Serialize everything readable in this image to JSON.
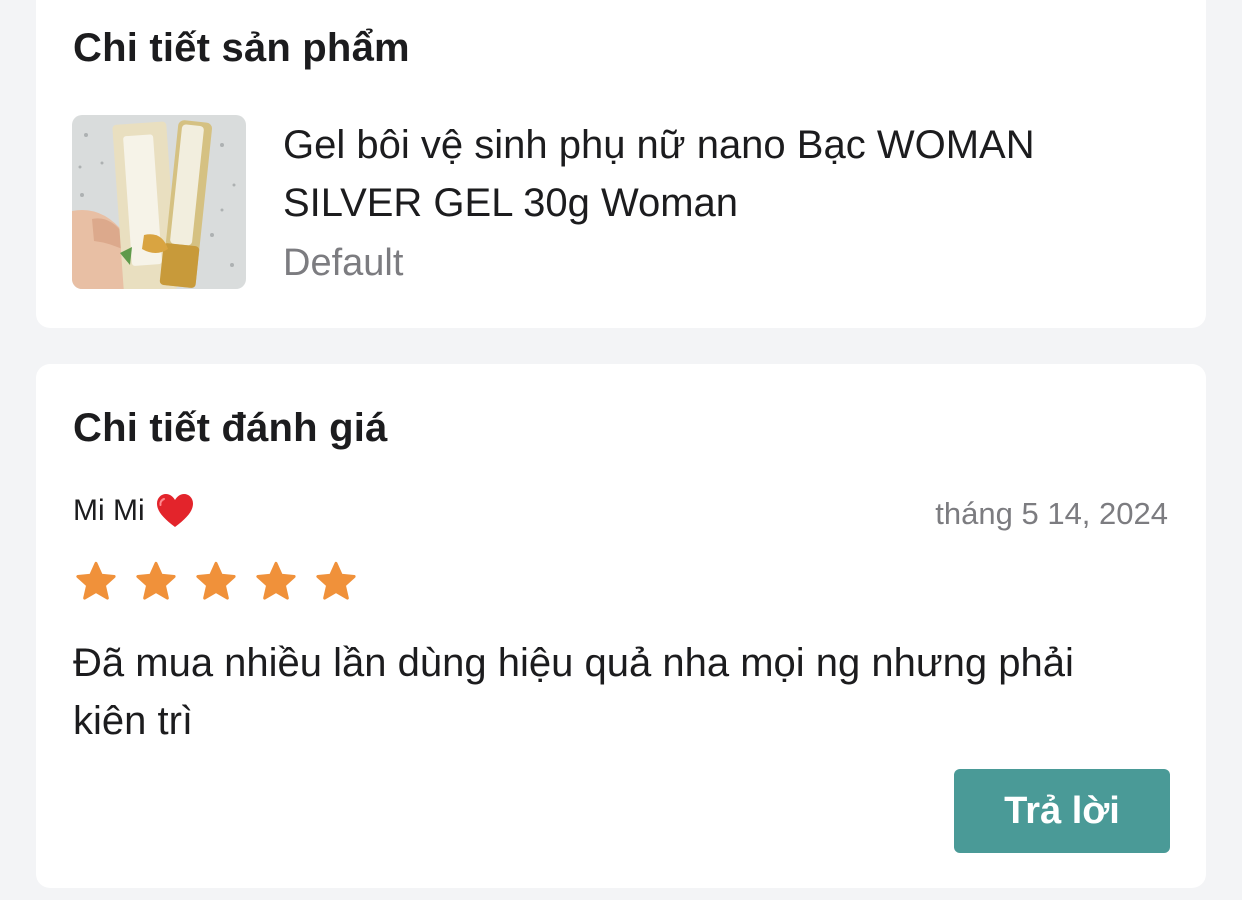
{
  "product_section": {
    "title": "Chi tiết sản phẩm",
    "product": {
      "name": "Gel bôi vệ sinh phụ nữ nano Bạc WOMAN SILVER GEL 30g Woman",
      "variant": "Default"
    }
  },
  "review_section": {
    "title": "Chi tiết đánh giá",
    "reviewer": "Mi Mi",
    "date": "tháng 5 14, 2024",
    "rating": 5,
    "rating_max": 5,
    "text": "Đã mua nhiều lần dùng hiệu quả nha mọi ng nhưng phải kiên trì",
    "reply_label": "Trả lời"
  },
  "colors": {
    "background": "#f3f4f6",
    "card": "#ffffff",
    "star": "#f0913a",
    "heart": "#e3242b",
    "button": "#4a9a97",
    "muted_text": "#7c7c80"
  },
  "icons": {
    "reviewer_badge": "heart-icon",
    "rating": "star-icon"
  }
}
